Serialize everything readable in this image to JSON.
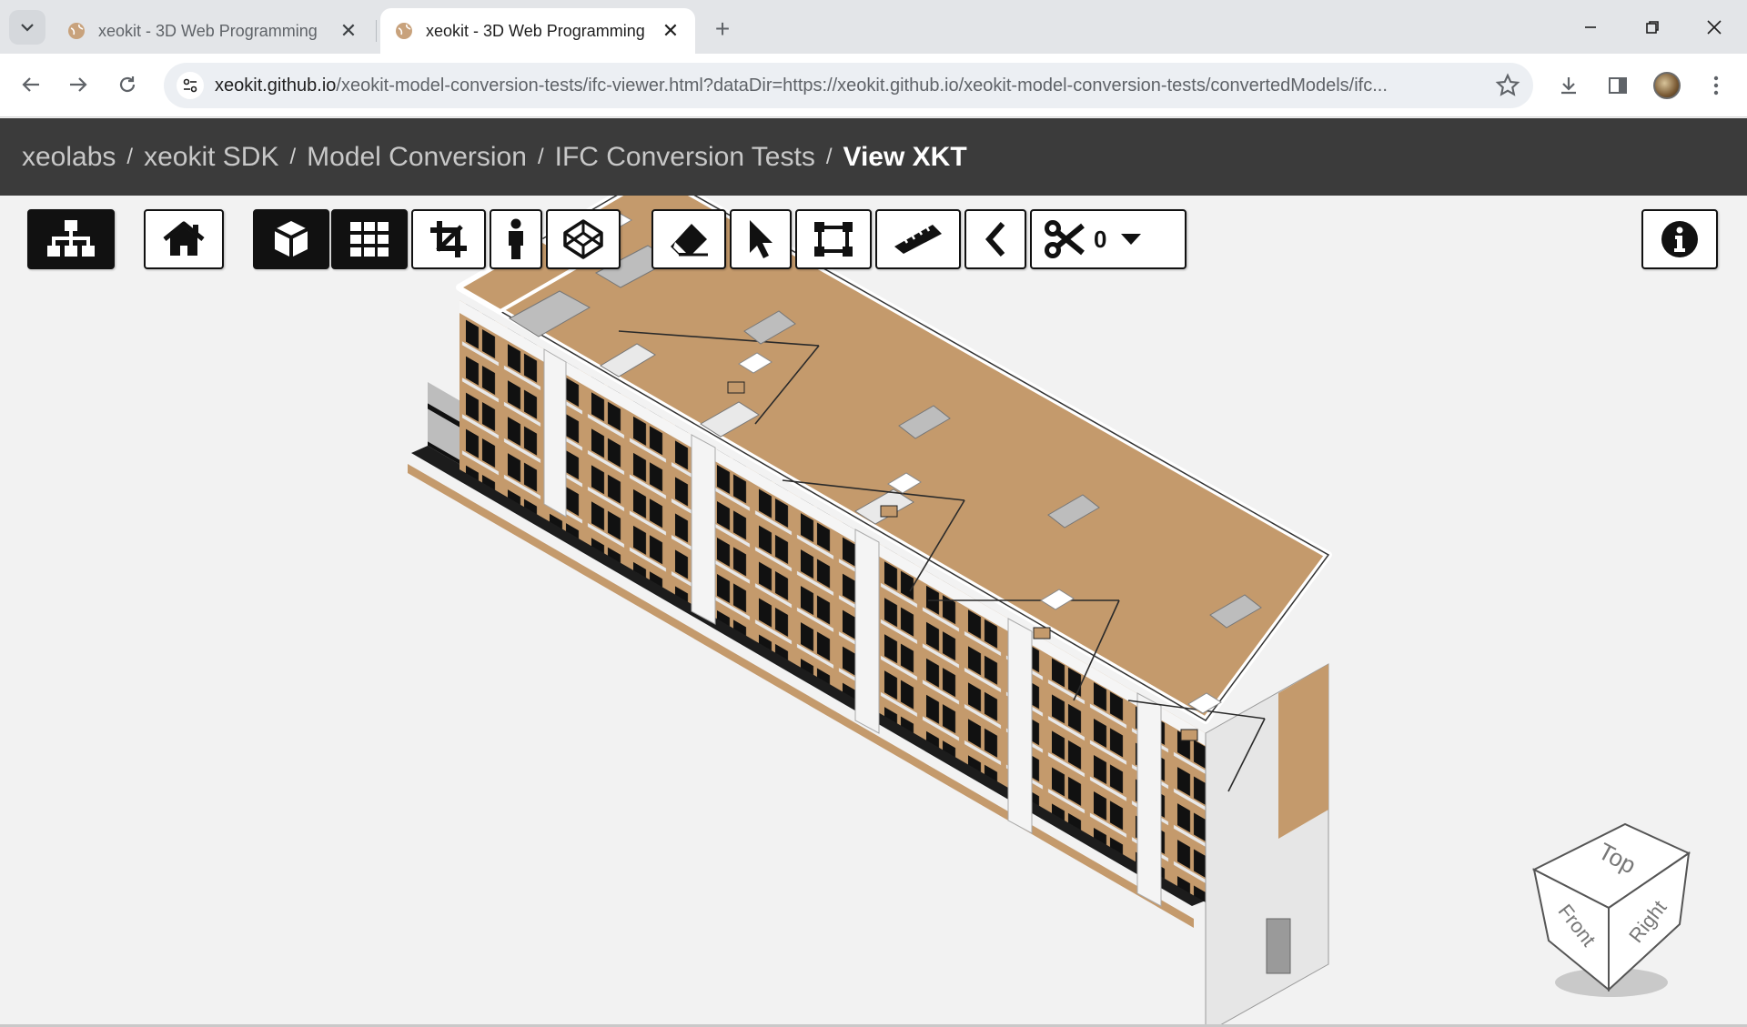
{
  "browser": {
    "tabs": [
      {
        "title": "xeokit - 3D Web Programming",
        "active": false
      },
      {
        "title": "xeokit - 3D Web Programming",
        "active": true
      }
    ],
    "url_host": "xeokit.github.io",
    "url_rest": "/xeokit-model-conversion-tests/ifc-viewer.html?dataDir=https://xeokit.github.io/xeokit-model-conversion-tests/convertedModels/ifc..."
  },
  "breadcrumb": {
    "items": [
      "xeolabs",
      "xeokit SDK",
      "Model Conversion",
      "IFC Conversion Tests"
    ],
    "current": "View XKT",
    "separator": "/"
  },
  "viewer_toolbar": {
    "tree_icon": "sitemap-icon",
    "home_icon": "home-icon",
    "perspective_icon": "cube-icon",
    "ortho_icon": "grid-icon",
    "fit_icon": "crop-icon",
    "firstperson_icon": "person-icon",
    "xray_icon": "codepen-cube-icon",
    "hide_icon": "eraser-icon",
    "select_icon": "pointer-icon",
    "marquee_icon": "marquee-select-icon",
    "measure_icon": "ruler-icon",
    "previous_icon": "chevron-left-icon",
    "section_icon": "scissors-icon",
    "section_count": "0",
    "info_icon": "info-icon"
  },
  "navcube": {
    "top": "Top",
    "front": "Front",
    "right": "Right"
  },
  "colors": {
    "breadcrumb_bg": "#3b3b3b",
    "roof": "#c49a6c",
    "background": "#f2f2f2"
  }
}
